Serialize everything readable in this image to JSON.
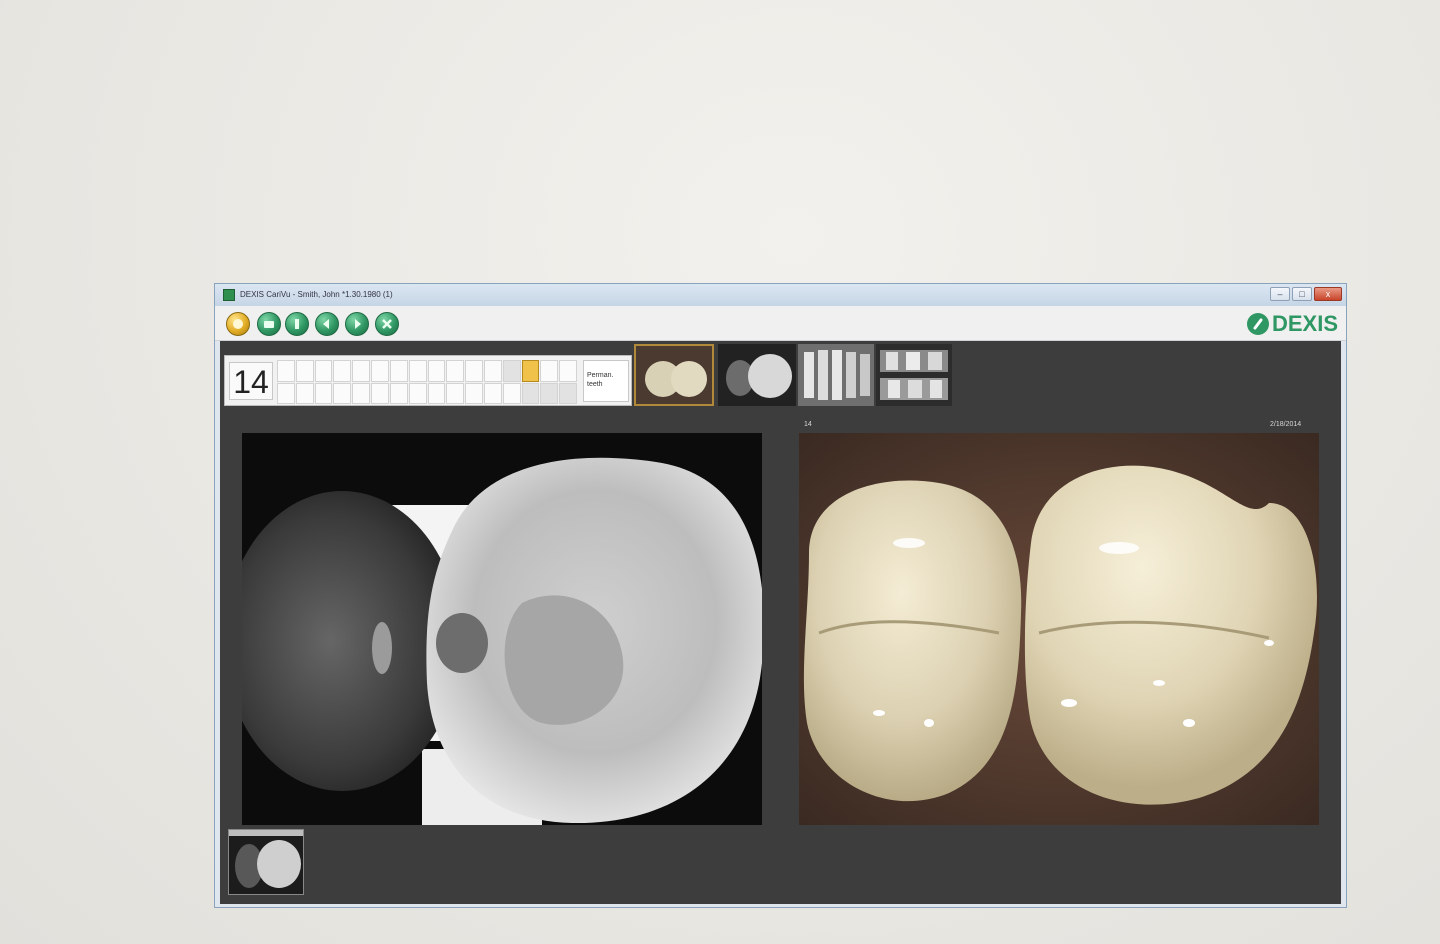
{
  "window": {
    "title": "DEXIS CariVu - Smith, John *1.30.1980 (1)",
    "controls": [
      "minimize",
      "maximize",
      "close"
    ],
    "close_label": "x",
    "minimize_label": "–",
    "maximize_label": "□"
  },
  "toolbar": {
    "buttons": [
      {
        "icon": "home-icon"
      },
      {
        "icon": "camera-icon"
      },
      {
        "icon": "settings-icon"
      },
      {
        "icon": "back-icon"
      },
      {
        "icon": "forward-icon"
      },
      {
        "icon": "close-icon"
      }
    ],
    "logo_text": "DEXIS"
  },
  "tooth_selector": {
    "selected_tooth": "14",
    "permanent_label": "Perman. teeth"
  },
  "thumbnails": [
    {
      "type": "intraoral-photo",
      "active": true
    },
    {
      "type": "transillumination"
    },
    {
      "type": "xray-anterior"
    },
    {
      "type": "xray-bitewing"
    }
  ],
  "viewer": {
    "right_header_left": "14",
    "right_header_right": "2/18/2014"
  },
  "colors": {
    "brand": "#2f9763",
    "window_background": "#3d3d3d",
    "selected_tooth": "#f0c24a"
  }
}
